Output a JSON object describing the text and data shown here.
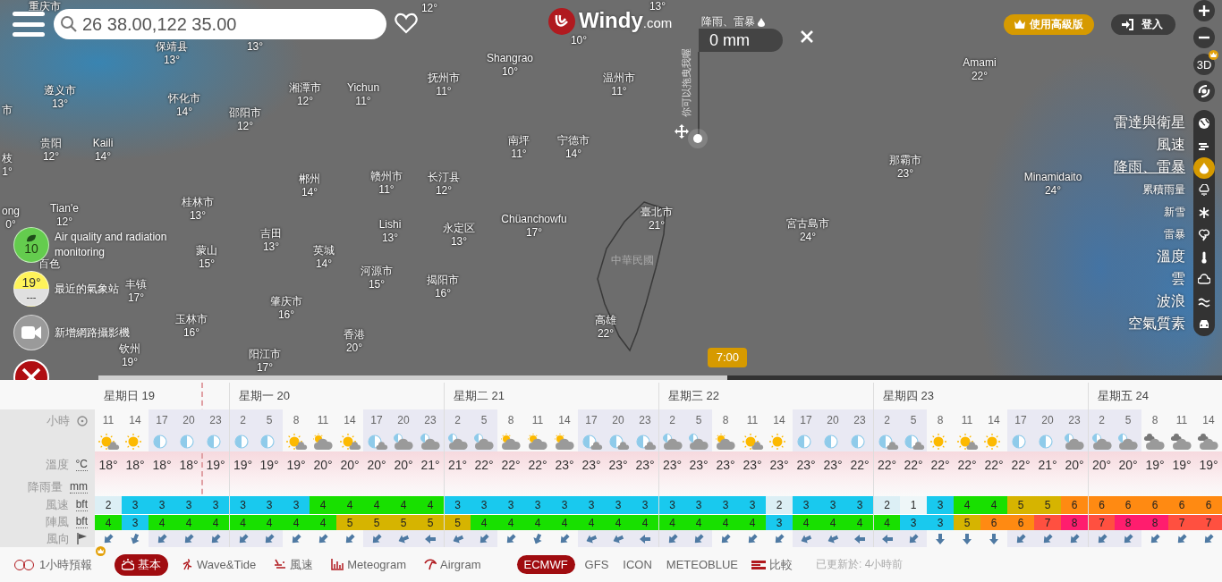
{
  "search": {
    "value": "26 38.00,122 35.00"
  },
  "logo": {
    "name": "Windy",
    "suffix": ".com"
  },
  "picker": {
    "layer": "降雨、雷暴",
    "value": "0 mm",
    "hint": "你可以拖曳我喔"
  },
  "premium_button": "使用高級版",
  "login_button": "登入",
  "three_d": "3D",
  "layers": [
    {
      "kind": "radar",
      "label": "雷達與衛星",
      "selected": false
    },
    {
      "kind": "wind",
      "label": "風速",
      "selected": false
    },
    {
      "kind": "rain",
      "label": "降雨、雷暴",
      "selected": true
    },
    {
      "kind": "accum",
      "label": "累積雨量",
      "selected": false
    },
    {
      "kind": "snow",
      "label": "新雪",
      "selected": false
    },
    {
      "kind": "thunder",
      "label": "雷暴",
      "selected": false
    },
    {
      "kind": "temp",
      "label": "溫度",
      "selected": false
    },
    {
      "kind": "clouds",
      "label": "雲",
      "selected": false
    },
    {
      "kind": "waves",
      "label": "波浪",
      "selected": false
    },
    {
      "kind": "air",
      "label": "空氣質素",
      "selected": false
    }
  ],
  "cities": [
    {
      "name": "重庆市"
    },
    {
      "temp": "12°"
    },
    {
      "temp": "13°"
    },
    {
      "name": "保靖县",
      "temp": "13°"
    },
    {
      "temp": "13°"
    },
    {
      "temp": "10°"
    },
    {
      "name": "Shangrao",
      "temp": "10°"
    },
    {
      "name": "Amami",
      "temp": "22°"
    },
    {
      "name": "遵义市",
      "temp": "13°"
    },
    {
      "name": "怀化市",
      "temp": "14°"
    },
    {
      "name": "湘潭市",
      "temp": "12°"
    },
    {
      "name": "Yichun",
      "temp": "11°"
    },
    {
      "name": "抚州市",
      "temp": "11°"
    },
    {
      "name": "温州市",
      "temp": "11°"
    },
    {
      "name": "市"
    },
    {
      "name": "邵阳市",
      "temp": "12°"
    },
    {
      "name": "贵阳",
      "temp": "12°"
    },
    {
      "name": "Kaili",
      "temp": "14°"
    },
    {
      "name": "南坪",
      "temp": "11°"
    },
    {
      "name": "宁德市",
      "temp": "14°"
    },
    {
      "name": "枝",
      "temp": "1°"
    },
    {
      "name": "郴州",
      "temp": "14°"
    },
    {
      "name": "赣州市",
      "temp": "11°"
    },
    {
      "name": "长汀县",
      "temp": "12°"
    },
    {
      "name": "那霸市",
      "temp": "23°"
    },
    {
      "name": "Minamidaito",
      "temp": "24°"
    },
    {
      "name": "ong",
      "temp": "0°"
    },
    {
      "name": "Tian'e",
      "temp": "12°"
    },
    {
      "name": "桂林市",
      "temp": "13°"
    },
    {
      "name": "吉田",
      "temp": "13°"
    },
    {
      "name": "Lishi",
      "temp": "13°"
    },
    {
      "name": "永定区",
      "temp": "13°"
    },
    {
      "name": "Chüanchowfu",
      "temp": "17°"
    },
    {
      "name": "臺北市",
      "temp": "21°"
    },
    {
      "name": "宮古島市",
      "temp": "24°"
    },
    {
      "name": "百色"
    },
    {
      "name": "丰镇",
      "temp": "17°"
    },
    {
      "name": "蒙山",
      "temp": "15°"
    },
    {
      "name": "英城",
      "temp": "14°"
    },
    {
      "name": "河源市",
      "temp": "15°"
    },
    {
      "name": "揭阳市",
      "temp": "16°"
    },
    {
      "name": "玉林市",
      "temp": "16°"
    },
    {
      "name": "肇庆市",
      "temp": "16°"
    },
    {
      "name": "高雄",
      "temp": "22°"
    },
    {
      "name": "钦州",
      "temp": "19°"
    },
    {
      "name": "阳江市",
      "temp": "17°"
    },
    {
      "name": "香港",
      "temp": "20°"
    }
  ],
  "country_label": "中華民國",
  "side_buttons": [
    {
      "kind": "air",
      "value": "10",
      "label": "Air quality and radiation monitoring"
    },
    {
      "kind": "station",
      "value": "19°",
      "sub": "---",
      "label": "最近的氣象站"
    },
    {
      "kind": "webcam",
      "label": "新增網路攝影機"
    }
  ],
  "timeline": {
    "time": "7:00",
    "level": 0.56
  },
  "forecast": {
    "row_labels": [
      {
        "kind": "hour",
        "label": "小時"
      },
      {
        "kind": "weather"
      },
      {
        "kind": "temp",
        "label": "溫度",
        "unit": "°C"
      },
      {
        "kind": "rain",
        "label": "降雨量",
        "unit": "mm"
      },
      {
        "kind": "wind",
        "label": "風速",
        "unit": "bft"
      },
      {
        "kind": "gust",
        "label": "陣風",
        "unit": "bft"
      },
      {
        "kind": "dir",
        "label": "風向"
      }
    ],
    "days": [
      {
        "label": "星期日 19",
        "hours": [
          {
            "hour": "11",
            "night": false,
            "weather": {
              "kind": "sun_cloud"
            },
            "temp": "18°",
            "wind": "2",
            "gust": "4",
            "arrow": {
              "kind": "NE"
            }
          },
          {
            "hour": "14",
            "night": false,
            "weather": {
              "kind": "sun"
            },
            "temp": "18°",
            "wind": "3",
            "gust": "3",
            "arrow": {
              "kind": "NNE"
            }
          },
          {
            "hour": "17",
            "night": true,
            "weather": {
              "kind": "moon"
            },
            "temp": "18°",
            "wind": "3",
            "gust": "4",
            "arrow": {
              "kind": "NE"
            }
          },
          {
            "hour": "20",
            "night": true,
            "weather": {
              "kind": "moon"
            },
            "temp": "18°",
            "wind": "3",
            "gust": "4",
            "arrow": {
              "kind": "NE"
            }
          },
          {
            "hour": "23",
            "night": true,
            "weather": {
              "kind": "moon"
            },
            "temp": "19°",
            "wind": "3",
            "gust": "4",
            "arrow": {
              "kind": "NE"
            }
          }
        ]
      },
      {
        "label": "星期一 20",
        "hours": [
          {
            "hour": "2",
            "night": true,
            "weather": {
              "kind": "moon"
            },
            "temp": "19°",
            "wind": "3",
            "gust": "4",
            "arrow": {
              "kind": "NE"
            }
          },
          {
            "hour": "5",
            "night": true,
            "weather": {
              "kind": "moon"
            },
            "temp": "19°",
            "wind": "3",
            "gust": "4",
            "arrow": {
              "kind": "NE"
            }
          },
          {
            "hour": "8",
            "night": false,
            "weather": {
              "kind": "sun_cloud"
            },
            "temp": "19°",
            "wind": "3",
            "gust": "4",
            "arrow": {
              "kind": "NE"
            }
          },
          {
            "hour": "11",
            "night": false,
            "weather": {
              "kind": "cloud_sun"
            },
            "temp": "20°",
            "wind": "4",
            "gust": "4",
            "arrow": {
              "kind": "NE"
            }
          },
          {
            "hour": "14",
            "night": false,
            "weather": {
              "kind": "sun_cloud"
            },
            "temp": "20°",
            "wind": "4",
            "gust": "5",
            "arrow": {
              "kind": "NE"
            }
          },
          {
            "hour": "17",
            "night": true,
            "weather": {
              "kind": "moon_cloud"
            },
            "temp": "20°",
            "wind": "4",
            "gust": "5",
            "arrow": {
              "kind": "NE"
            }
          },
          {
            "hour": "20",
            "night": true,
            "weather": {
              "kind": "cloud_moon"
            },
            "temp": "20°",
            "wind": "4",
            "gust": "5",
            "arrow": {
              "kind": "ENE"
            }
          },
          {
            "hour": "23",
            "night": true,
            "weather": {
              "kind": "cloud_moon"
            },
            "temp": "21°",
            "wind": "4",
            "gust": "5",
            "arrow": {
              "kind": "E"
            }
          }
        ]
      },
      {
        "label": "星期二 21",
        "hours": [
          {
            "hour": "2",
            "night": true,
            "weather": {
              "kind": "cloud_moon"
            },
            "temp": "21°",
            "wind": "3",
            "gust": "5",
            "arrow": {
              "kind": "ENE"
            }
          },
          {
            "hour": "5",
            "night": true,
            "weather": {
              "kind": "cloud_moon"
            },
            "temp": "22°",
            "wind": "3",
            "gust": "4",
            "arrow": {
              "kind": "NE"
            }
          },
          {
            "hour": "8",
            "night": false,
            "weather": {
              "kind": "cloud_sun"
            },
            "temp": "22°",
            "wind": "3",
            "gust": "4",
            "arrow": {
              "kind": "NE"
            }
          },
          {
            "hour": "11",
            "night": false,
            "weather": {
              "kind": "cloud_sun"
            },
            "temp": "22°",
            "wind": "3",
            "gust": "4",
            "arrow": {
              "kind": "NNE"
            }
          },
          {
            "hour": "14",
            "night": false,
            "weather": {
              "kind": "cloud_sun"
            },
            "temp": "23°",
            "wind": "3",
            "gust": "4",
            "arrow": {
              "kind": "NE"
            }
          },
          {
            "hour": "17",
            "night": true,
            "weather": {
              "kind": "moon_cloud"
            },
            "temp": "23°",
            "wind": "3",
            "gust": "4",
            "arrow": {
              "kind": "ENE"
            }
          },
          {
            "hour": "20",
            "night": true,
            "weather": {
              "kind": "moon_cloud"
            },
            "temp": "23°",
            "wind": "3",
            "gust": "4",
            "arrow": {
              "kind": "ENE"
            }
          },
          {
            "hour": "23",
            "night": true,
            "weather": {
              "kind": "moon_cloud"
            },
            "temp": "23°",
            "wind": "3",
            "gust": "4",
            "arrow": {
              "kind": "E"
            }
          }
        ]
      },
      {
        "label": "星期三 22",
        "hours": [
          {
            "hour": "2",
            "night": true,
            "weather": {
              "kind": "cloud_moon"
            },
            "temp": "23°",
            "wind": "3",
            "gust": "4",
            "arrow": {
              "kind": "NE"
            }
          },
          {
            "hour": "5",
            "night": true,
            "weather": {
              "kind": "cloud_moon"
            },
            "temp": "23°",
            "wind": "3",
            "gust": "4",
            "arrow": {
              "kind": "NE"
            }
          },
          {
            "hour": "8",
            "night": false,
            "weather": {
              "kind": "cloud_sun"
            },
            "temp": "23°",
            "wind": "3",
            "gust": "4",
            "arrow": {
              "kind": "NE"
            }
          },
          {
            "hour": "11",
            "night": false,
            "weather": {
              "kind": "sun_cloud"
            },
            "temp": "23°",
            "wind": "3",
            "gust": "4",
            "arrow": {
              "kind": "NE"
            }
          },
          {
            "hour": "14",
            "night": false,
            "weather": {
              "kind": "sun"
            },
            "temp": "23°",
            "wind": "2",
            "gust": "3",
            "arrow": {
              "kind": "NE"
            }
          },
          {
            "hour": "17",
            "night": true,
            "weather": {
              "kind": "moon"
            },
            "temp": "23°",
            "wind": "3",
            "gust": "4",
            "arrow": {
              "kind": "ENE"
            }
          },
          {
            "hour": "20",
            "night": true,
            "weather": {
              "kind": "moon"
            },
            "temp": "23°",
            "wind": "3",
            "gust": "4",
            "arrow": {
              "kind": "ENE"
            }
          },
          {
            "hour": "23",
            "night": true,
            "weather": {
              "kind": "moon"
            },
            "temp": "22°",
            "wind": "3",
            "gust": "4",
            "arrow": {
              "kind": "E"
            }
          }
        ]
      },
      {
        "label": "星期四 23",
        "hours": [
          {
            "hour": "2",
            "night": true,
            "weather": {
              "kind": "moon_cloud"
            },
            "temp": "22°",
            "wind": "2",
            "gust": "4",
            "arrow": {
              "kind": "E"
            }
          },
          {
            "hour": "5",
            "night": true,
            "weather": {
              "kind": "moon_cloud"
            },
            "temp": "22°",
            "wind": "1",
            "gust": "3",
            "arrow": {
              "kind": "NE"
            }
          },
          {
            "hour": "8",
            "night": false,
            "weather": {
              "kind": "sun"
            },
            "temp": "22°",
            "wind": "3",
            "gust": "3",
            "arrow": {
              "kind": "N"
            }
          },
          {
            "hour": "11",
            "night": false,
            "weather": {
              "kind": "sun_cloud"
            },
            "temp": "22°",
            "wind": "4",
            "gust": "5",
            "arrow": {
              "kind": "N"
            }
          },
          {
            "hour": "14",
            "night": false,
            "weather": {
              "kind": "sun"
            },
            "temp": "22°",
            "wind": "4",
            "gust": "6",
            "arrow": {
              "kind": "N"
            }
          },
          {
            "hour": "17",
            "night": true,
            "weather": {
              "kind": "moon"
            },
            "temp": "22°",
            "wind": "5",
            "gust": "6",
            "arrow": {
              "kind": "NE"
            }
          },
          {
            "hour": "20",
            "night": true,
            "weather": {
              "kind": "moon"
            },
            "temp": "21°",
            "wind": "5",
            "gust": "7",
            "arrow": {
              "kind": "NE"
            }
          },
          {
            "hour": "23",
            "night": true,
            "weather": {
              "kind": "cloud_moon"
            },
            "temp": "20°",
            "wind": "6",
            "gust": "8",
            "arrow": {
              "kind": "NE"
            }
          }
        ]
      },
      {
        "label": "星期五 24",
        "hours": [
          {
            "hour": "2",
            "night": true,
            "weather": {
              "kind": "cloud_moon"
            },
            "temp": "20°",
            "wind": "6",
            "gust": "7",
            "arrow": {
              "kind": "NE"
            }
          },
          {
            "hour": "5",
            "night": true,
            "weather": {
              "kind": "cloud_moon"
            },
            "temp": "20°",
            "wind": "6",
            "gust": "8",
            "arrow": {
              "kind": "NE"
            }
          },
          {
            "hour": "8",
            "night": false,
            "weather": {
              "kind": "cloud"
            },
            "temp": "19°",
            "wind": "6",
            "gust": "8",
            "arrow": {
              "kind": "NE"
            }
          },
          {
            "hour": "11",
            "night": false,
            "weather": {
              "kind": "cloud"
            },
            "temp": "19°",
            "wind": "6",
            "gust": "7",
            "arrow": {
              "kind": "NE"
            }
          },
          {
            "hour": "14",
            "night": false,
            "weather": {
              "kind": "cloud"
            },
            "temp": "19°",
            "wind": "6",
            "gust": "7",
            "arrow": {
              "kind": "NE"
            }
          }
        ]
      }
    ]
  },
  "footer": {
    "hourly_toggle": {
      "label": "1小時預報",
      "on": false
    },
    "views": [
      {
        "kind": "basic",
        "label": "基本",
        "selected": true
      },
      {
        "kind": "wave",
        "label": "Wave&Tide",
        "selected": false
      },
      {
        "kind": "wind",
        "label": "風速",
        "selected": false
      },
      {
        "kind": "meteogram",
        "label": "Meteogram",
        "selected": false
      },
      {
        "kind": "airgram",
        "label": "Airgram",
        "selected": false
      }
    ],
    "models": [
      {
        "label": "ECMWF",
        "selected": true
      },
      {
        "label": "GFS",
        "selected": false
      },
      {
        "label": "ICON",
        "selected": false
      },
      {
        "label": "METEOBLUE",
        "selected": false
      }
    ],
    "compare": "比較",
    "updated": "已更新於: 4小時前"
  }
}
